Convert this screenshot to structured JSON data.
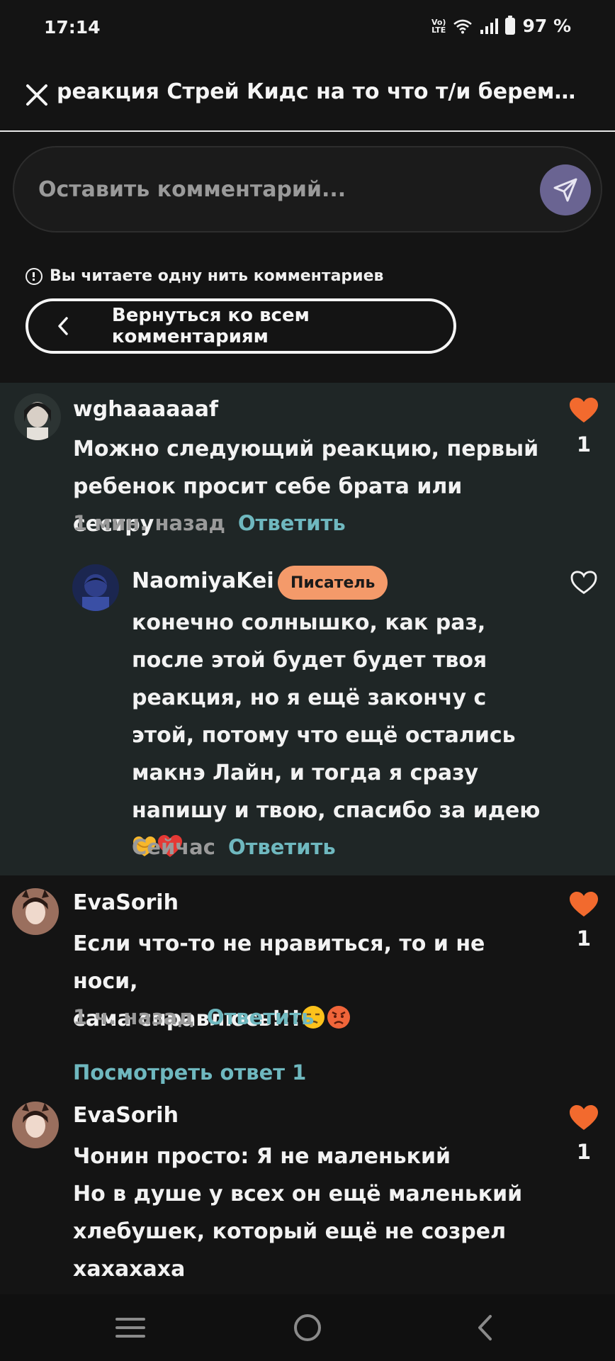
{
  "status_bar": {
    "time": "17:14",
    "volte_top": "Vo)",
    "volte_bottom": "LTE",
    "battery": "97 %"
  },
  "header": {
    "title": "реакция Стрей Кидс на то что т/и беременна"
  },
  "comment_input": {
    "placeholder": "Оставить комментарий..."
  },
  "thread": {
    "notice": "Вы читаете одну нить комментариев",
    "back_label": "Вернуться ко всем комментариям"
  },
  "comments": [
    {
      "username": "wghaaaaaaf",
      "text": "Можно следующий реакцию, первый ребенок просит себе брата или сестру",
      "time": "1 мин. назад",
      "reply_label": "Ответить",
      "likes": "1",
      "liked": true
    },
    {
      "username": "NaomiyaKei",
      "badge": "Писатель",
      "text": "конечно солнышко, как раз, после этой будет будет твоя реакция, но я ещё закончу с этой, потому что ещё остались макнэ Лайн, и тогда я сразу напишу и твою, спасибо за идею",
      "time": "Сейчас",
      "reply_label": "Ответить",
      "liked": false
    },
    {
      "username": "EvaSorih",
      "text_line1": "Если что-то не нравиться, то и не носи,",
      "text_line2": "сама справлюсь!!!",
      "time": "1 ч. назад",
      "reply_label": "Ответить",
      "likes": "1",
      "liked": true
    },
    {
      "username": "EvaSorih",
      "text": "Чонин просто: Я не маленький\nНо в душе у всех он ещё маленький хлебушек, который ещё не созрел хахахаха",
      "likes": "1",
      "liked": true
    }
  ],
  "view_replies": "Посмотреть ответ 1",
  "colors": {
    "like": "#f26a2e",
    "reply": "#6fb8bf",
    "badge": "#f49a6a",
    "send": "#6a6492"
  },
  "icons": [
    "close-icon",
    "send-icon",
    "info-icon",
    "chevron-left-icon",
    "heart-icon",
    "heart-outline-icon",
    "menu-icon",
    "home-icon",
    "back-icon"
  ]
}
